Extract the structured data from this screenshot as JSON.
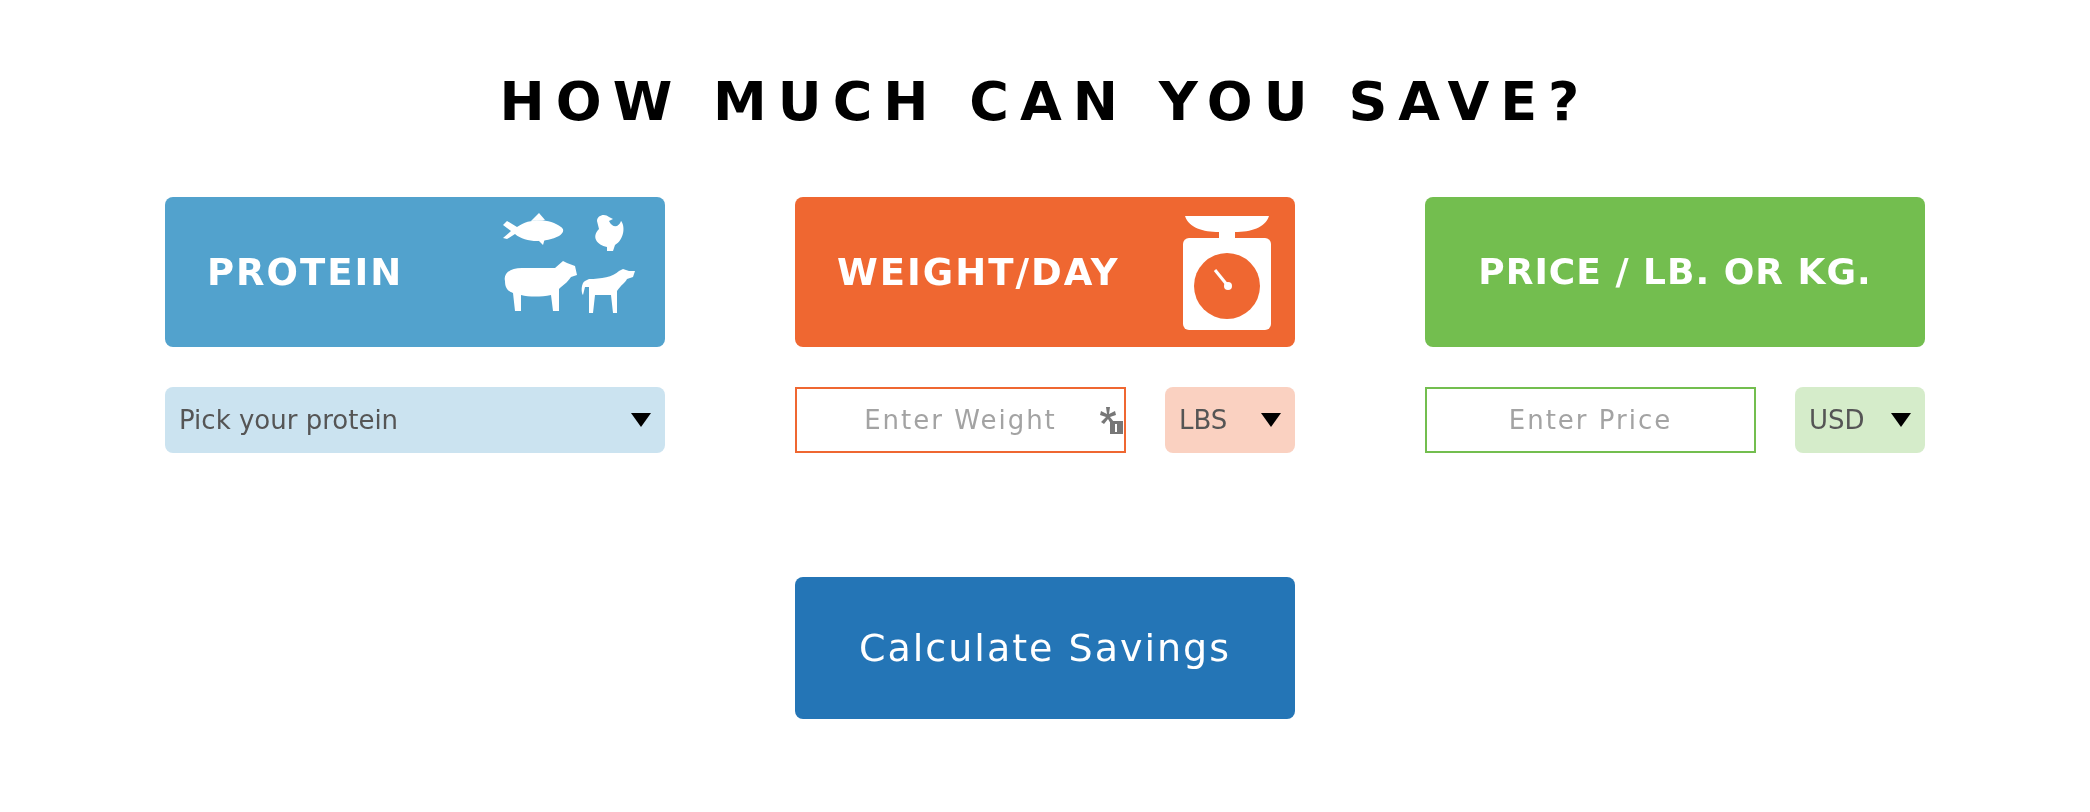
{
  "title": "HOW MUCH CAN YOU SAVE?",
  "fields": [
    {
      "kind": "protein",
      "label": "PROTEIN",
      "color": "#52a2cd",
      "select": {
        "value": "Pick your protein"
      }
    },
    {
      "kind": "weight",
      "label": "WEIGHT/DAY",
      "color": "#ef6731",
      "input": {
        "placeholder": "Enter Weight"
      },
      "unit": {
        "value": "LBS"
      }
    },
    {
      "kind": "price",
      "label": "PRICE / LB. OR KG.",
      "color": "#73be4f",
      "input": {
        "placeholder": "Enter Price"
      },
      "unit": {
        "value": "USD"
      }
    }
  ],
  "button": {
    "label": "Calculate Savings"
  }
}
